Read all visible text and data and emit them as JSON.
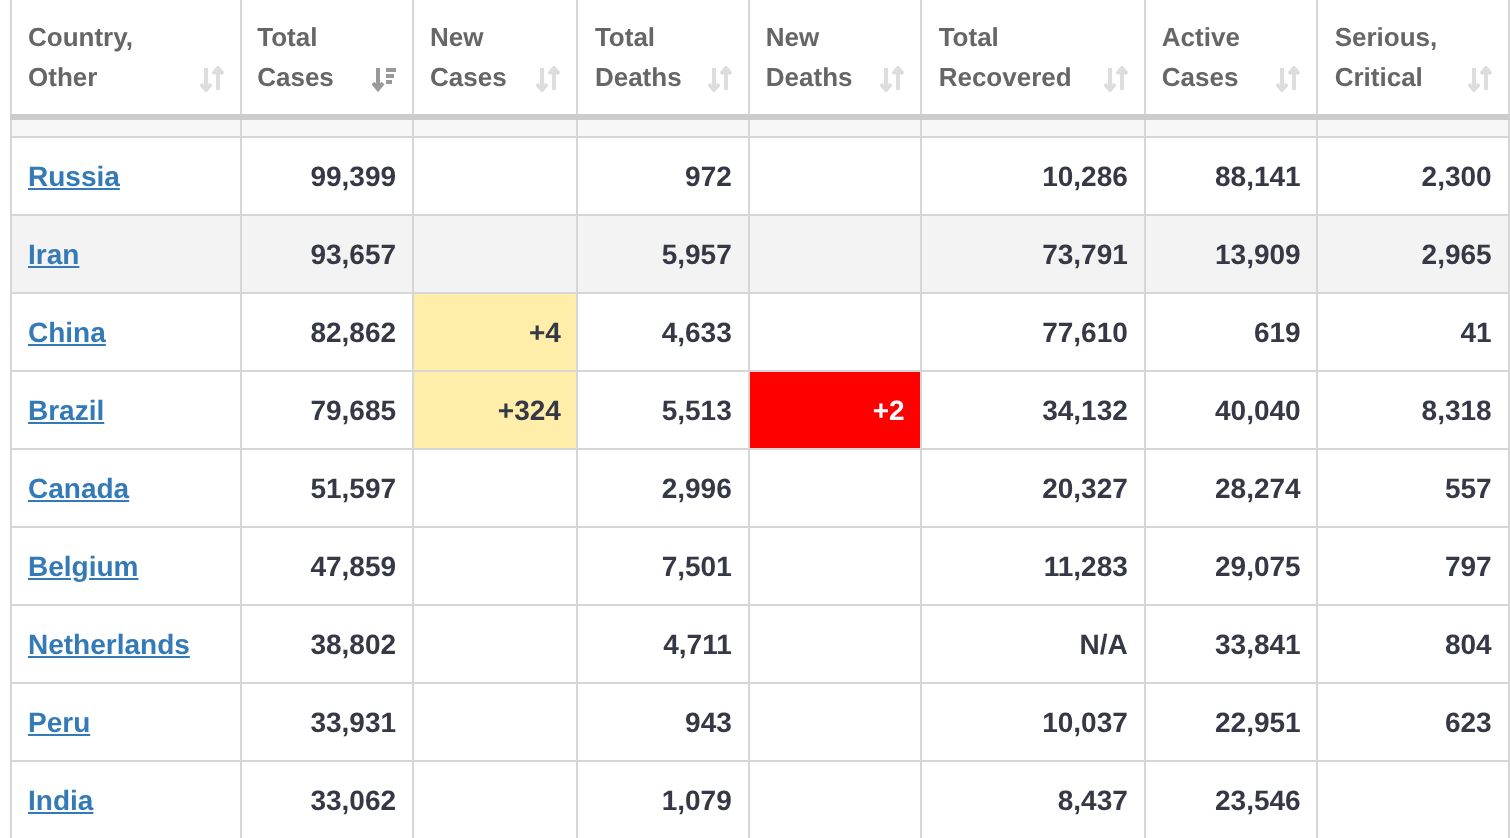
{
  "table": {
    "columns": [
      {
        "label": "Country, Other",
        "kind": "link",
        "sorted": false
      },
      {
        "label": "Total Cases",
        "kind": "number",
        "sorted": true
      },
      {
        "label": "New Cases",
        "kind": "new_cases",
        "sorted": false
      },
      {
        "label": "Total Deaths",
        "kind": "number",
        "sorted": false
      },
      {
        "label": "New Deaths",
        "kind": "new_deaths",
        "sorted": false
      },
      {
        "label": "Total Recovered",
        "kind": "number",
        "sorted": false
      },
      {
        "label": "Active Cases",
        "kind": "number",
        "sorted": false
      },
      {
        "label": "Serious, Critical",
        "kind": "number",
        "sorted": false
      }
    ],
    "rows": [
      {
        "shaded": false,
        "cells": [
          "Russia",
          "99,399",
          null,
          "972",
          null,
          "10,286",
          "88,141",
          "2,300"
        ]
      },
      {
        "shaded": true,
        "cells": [
          "Iran",
          "93,657",
          null,
          "5,957",
          null,
          "73,791",
          "13,909",
          "2,965"
        ]
      },
      {
        "shaded": false,
        "cells": [
          "China",
          "82,862",
          "+4",
          "4,633",
          null,
          "77,610",
          "619",
          "41"
        ]
      },
      {
        "shaded": false,
        "cells": [
          "Brazil",
          "79,685",
          "+324",
          "5,513",
          "+2",
          "34,132",
          "40,040",
          "8,318"
        ]
      },
      {
        "shaded": false,
        "cells": [
          "Canada",
          "51,597",
          null,
          "2,996",
          null,
          "20,327",
          "28,274",
          "557"
        ]
      },
      {
        "shaded": false,
        "cells": [
          "Belgium",
          "47,859",
          null,
          "7,501",
          null,
          "11,283",
          "29,075",
          "797"
        ]
      },
      {
        "shaded": false,
        "cells": [
          "Netherlands",
          "38,802",
          null,
          "4,711",
          null,
          "N/A",
          "33,841",
          "804"
        ]
      },
      {
        "shaded": false,
        "cells": [
          "Peru",
          "33,931",
          null,
          "943",
          null,
          "10,037",
          "22,951",
          "623"
        ]
      },
      {
        "shaded": false,
        "cells": [
          "India",
          "33,062",
          null,
          "1,079",
          null,
          "8,437",
          "23,546",
          null
        ]
      }
    ]
  }
}
